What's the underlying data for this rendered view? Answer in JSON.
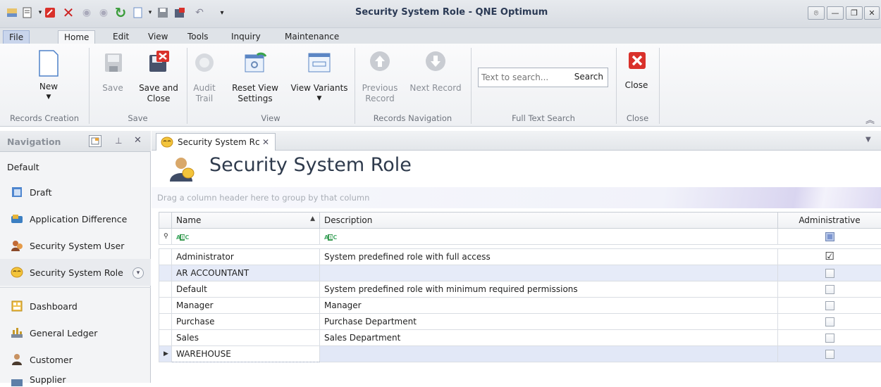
{
  "window": {
    "title": "Security System Role - QNE Optimum"
  },
  "ribbon_tabs": [
    "File",
    "Home",
    "Edit",
    "View",
    "Tools",
    "Inquiry",
    "Maintenance"
  ],
  "ribbon": {
    "new": "New",
    "save": "Save",
    "save_close_1": "Save and",
    "save_close_2": "Close",
    "audit_1": "Audit",
    "audit_2": "Trail",
    "reset_1": "Reset View",
    "reset_2": "Settings",
    "view_variants": "View Variants",
    "prev_1": "Previous",
    "prev_2": "Record",
    "next": "Next Record",
    "search_placeholder": "Text to search...",
    "search_button": "Search",
    "close": "Close",
    "groups": [
      "Records Creation",
      "Save",
      "View",
      "Records Navigation",
      "Full Text Search",
      "Close"
    ]
  },
  "navigation": {
    "header": "Navigation",
    "section": "Default",
    "items": [
      "Draft",
      "Application Difference",
      "Security System User",
      "Security System Role",
      "Dashboard",
      "General Ledger",
      "Customer",
      "Supplier"
    ]
  },
  "document": {
    "tab_label": "Security System Rc",
    "title": "Security System Role",
    "group_hint": "Drag a column header here to group by that column"
  },
  "grid": {
    "columns": [
      "Name",
      "Description",
      "Administrative"
    ],
    "rows": [
      {
        "name": "Administrator",
        "description": "System predefined role with full access",
        "administrative": true
      },
      {
        "name": "AR ACCOUNTANT",
        "description": "",
        "administrative": false
      },
      {
        "name": "Default",
        "description": "System predefined role with minimum required permissions",
        "administrative": false
      },
      {
        "name": "Manager",
        "description": "Manager",
        "administrative": false
      },
      {
        "name": "Purchase",
        "description": "Purchase Department",
        "administrative": false
      },
      {
        "name": "Sales",
        "description": "Sales Department",
        "administrative": false
      },
      {
        "name": "WAREHOUSE",
        "description": "",
        "administrative": false
      }
    ]
  },
  "colors": {
    "accent": "#2b3a55",
    "selection": "#e6ebf8",
    "close_red": "#d9312b"
  }
}
